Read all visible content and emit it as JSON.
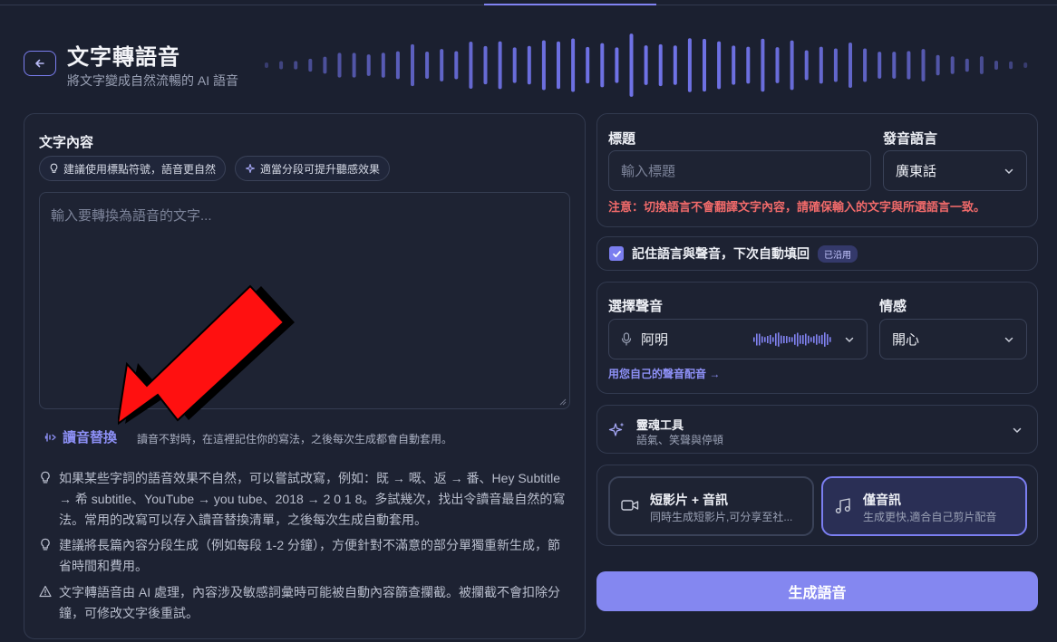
{
  "header": {
    "title": "文字轉語音",
    "subtitle": "將文字變成自然流暢的 AI 語音"
  },
  "text_panel": {
    "label": "文字內容",
    "chips": [
      {
        "label": "建議使用標點符號，語音更自然"
      },
      {
        "label": "適當分段可提升聽感效果"
      }
    ],
    "textarea_placeholder": "輸入要轉換為語音的文字...",
    "replace_link": "讀音替換",
    "replace_desc": "讀音不對時，在這裡記住你的寫法，之後每次生成都會自動套用。",
    "tips": [
      {
        "text": "如果某些字詞的語音效果不自然，可以嘗試改寫，例如：既 → 嘅、返 → 番、Hey Subtitle → 希 subtitle、YouTube → you tube、2018 → 2 0 1 8。多試幾次，找出令讀音最自然的寫法。常用的改寫可以存入讀音替換清單，之後每次生成自動套用。"
      },
      {
        "text": "建議將長篇內容分段生成（例如每段 1-2 分鐘），方便針對不滿意的部分單獨重新生成，節省時間和費用。"
      },
      {
        "text": "文字轉語音由 AI 處理，內容涉及敏感詞彙時可能被自動內容篩查攔截。被攔截不會扣除分鐘，可修改文字後重試。"
      }
    ]
  },
  "settings": {
    "title_label": "標題",
    "title_placeholder": "輸入標題",
    "language_label": "發音語言",
    "language_value": "廣東話",
    "warning": "注意：切換語言不會翻譯文字內容，請確保輸入的文字與所選語言一致。",
    "remember_label": "記住語言與聲音，下次自動填回",
    "remember_checked": true,
    "remember_badge": "已沿用",
    "voice_label": "選擇聲音",
    "voice_value": "阿明",
    "emotion_label": "情感",
    "emotion_value": "開心",
    "voice_link": "用您自己的聲音配音 →",
    "tools_title": "靈魂工具",
    "tools_sub": "語氣、笑聲與停頓",
    "outputs": [
      {
        "title": "短影片 + 音訊",
        "sub": "同時生成短影片,可分享至社...",
        "selected": false
      },
      {
        "title": "僅音訊",
        "sub": "生成更快,適合自己剪片配音",
        "selected": true
      }
    ],
    "generate_label": "生成語音"
  },
  "colors": {
    "accent": "#7b7ef0",
    "background": "#1b2030",
    "warning": "#f06a6a"
  }
}
